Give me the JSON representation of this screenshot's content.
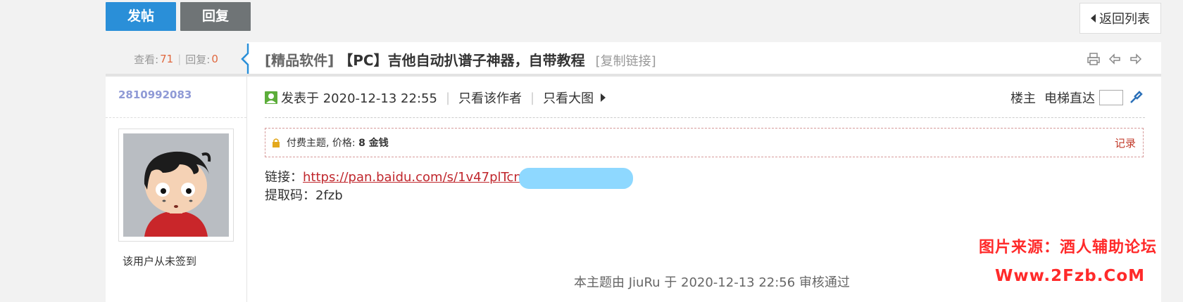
{
  "toolbar": {
    "post_label": "发帖",
    "reply_label": "回复",
    "back_label": "返回列表"
  },
  "thread": {
    "views_label": "查看:",
    "views": "71",
    "replies_label": "回复:",
    "replies": "0",
    "category": "[精品软件]",
    "title": "【PC】吉他自动扒谱子神器，自带教程",
    "copy_link": "[复制链接]"
  },
  "post": {
    "author": "2810992083",
    "sign_status": "该用户从未签到",
    "posted_at": "发表于 2020-12-13 22:55",
    "only_author": "只看该作者",
    "large_images": "只看大图",
    "floor": "楼主",
    "elevator": "电梯直达",
    "paid_notice_prefix": "付费主题, 价格: ",
    "paid_price": "8 金钱",
    "record": "记录",
    "link_label": "链接：",
    "link_text": "https://pan.baidu.com/s/1v47plTcn_2",
    "code_label": "提取码：",
    "code_value": "2fzb",
    "approval": "本主题由 JiuRu 于 2020-12-13 22:56 审核通过"
  },
  "watermark": {
    "line1": "图片来源：酒人辅助论坛",
    "line2": "Www.2Fzb.CoM"
  },
  "colors": {
    "post_button": "#2a8fd8",
    "reply_button": "#6f7476",
    "link": "#c0272d",
    "author": "#8f9ad6",
    "stat_number": "#e0683f"
  }
}
